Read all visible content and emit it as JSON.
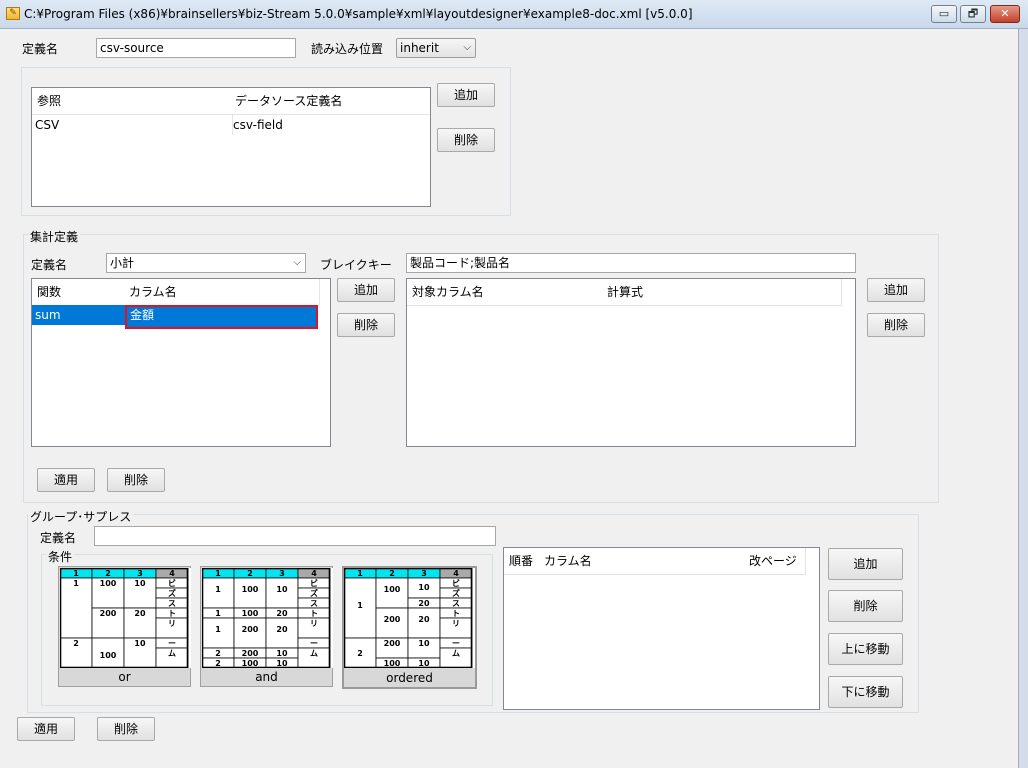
{
  "window": {
    "title": "C:¥Program Files (x86)¥brainsellers¥biz-Stream 5.0.0¥sample¥xml¥layoutdesigner¥example8-doc.xml [v5.0.0]",
    "icon": "document-edit-icon",
    "minimize": "▭",
    "maximize": "🗗",
    "close": "✕"
  },
  "definition": {
    "name_label": "定義名",
    "name_value": "csv-source",
    "read_position_label": "読み込み位置",
    "read_position_value": "inherit"
  },
  "reference_table": {
    "columns": [
      "参照",
      "データソース定義名"
    ],
    "rows": [
      [
        "CSV",
        "csv-field"
      ]
    ],
    "add_label": "追加",
    "delete_label": "削除"
  },
  "aggregate": {
    "group_title": "集計定義",
    "name_label": "定義名",
    "name_value": "小計",
    "break_key_label": "ブレイクキー",
    "break_key_value": "製品コード;製品名",
    "func_table": {
      "columns": [
        "関数",
        "カラム名"
      ],
      "rows": [
        [
          "sum",
          "金額"
        ]
      ]
    },
    "target_table": {
      "columns": [
        "対象カラム名",
        "計算式"
      ]
    },
    "add_label": "追加",
    "delete_label": "削除",
    "apply_label": "適用",
    "bottom_delete_label": "削除"
  },
  "group_suppress": {
    "group_title": "グループ･サプレス",
    "name_label": "定義名",
    "name_value": "",
    "condition_label": "条件",
    "options": [
      "or",
      "and",
      "ordered"
    ],
    "order_table": {
      "columns": [
        "順番",
        "カラム名",
        "改ページ"
      ]
    },
    "add_label": "追加",
    "delete_label": "削除",
    "move_up_label": "上に移動",
    "move_down_label": "下に移動"
  },
  "mini_header": [
    "1",
    "2",
    "3",
    "4"
  ],
  "mini_letters": [
    "ビ",
    "ズ",
    "ス",
    "ト",
    "リ",
    "ー",
    "ム"
  ],
  "mini_or": {
    "c1": [
      "1",
      "2"
    ],
    "c2": [
      "100",
      "200",
      "100"
    ],
    "c3": [
      "10",
      "20",
      "10"
    ]
  },
  "mini_and": {
    "c1": [
      "1",
      "1",
      "1",
      "2",
      "2"
    ],
    "c2": [
      "100",
      "100",
      "200",
      "200",
      "100"
    ],
    "c3": [
      "10",
      "20",
      "20",
      "10",
      "10"
    ]
  },
  "mini_ordered": {
    "c1": [
      "1",
      "2"
    ],
    "c2": [
      "100",
      "200",
      "200",
      "100"
    ],
    "c3": [
      "10",
      "20",
      "20",
      "10",
      "10"
    ]
  },
  "bottom": {
    "apply_label": "適用",
    "delete_label": "削除"
  },
  "colors": {
    "selection": "#0078d7",
    "highlight_border": "#e0141e",
    "mini_header": "#00e5ee"
  }
}
